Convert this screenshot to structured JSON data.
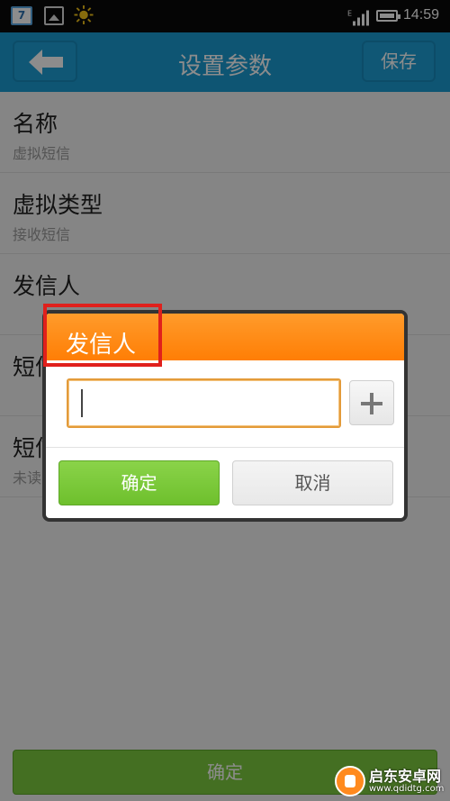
{
  "status_bar": {
    "calendar_day": "7",
    "network": "E",
    "time": "14:59",
    "icons": [
      "calendar-icon",
      "gallery-icon",
      "weather-sun-icon",
      "signal-icon",
      "battery-icon"
    ]
  },
  "header": {
    "title": "设置参数",
    "save_label": "保存",
    "back_icon": "back-arrow-icon"
  },
  "settings": {
    "items": [
      {
        "label": "名称",
        "value": "虚拟短信"
      },
      {
        "label": "虚拟类型",
        "value": "接收短信"
      },
      {
        "label": "发信人",
        "value": ""
      },
      {
        "label": "短信",
        "value": ""
      },
      {
        "label": "短信",
        "value": "未读"
      }
    ]
  },
  "dialog": {
    "title": "发信人",
    "input_value": "",
    "add_icon": "plus-icon",
    "confirm_label": "确定",
    "cancel_label": "取消"
  },
  "bottom": {
    "confirm_label": "确定"
  },
  "watermark": {
    "name": "启东安卓网",
    "url": "www.qdidtg.com"
  },
  "colors": {
    "header_blue": "#1b9bd2",
    "dialog_orange": "#ff8a12",
    "confirm_green": "#7ccb3f",
    "highlight_red": "#e0201c"
  }
}
